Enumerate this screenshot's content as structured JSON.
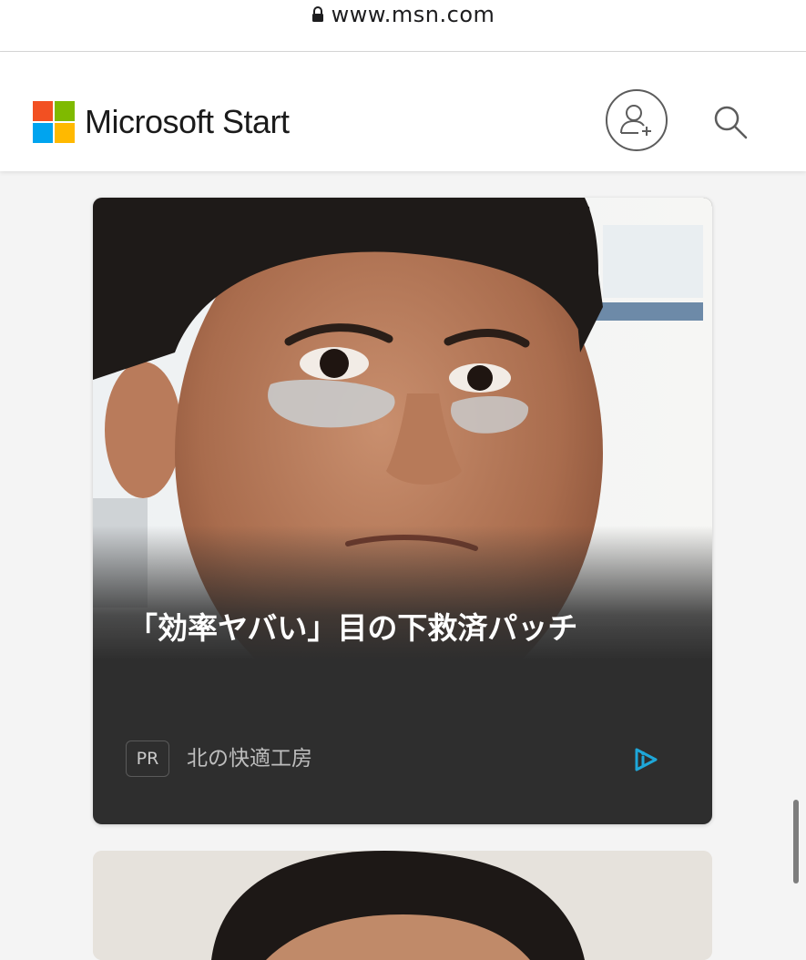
{
  "browser": {
    "url": "www.msn.com",
    "icons": {
      "lock": "lock-icon"
    }
  },
  "header": {
    "brand": "Microsoft Start",
    "logo_colors": [
      "#f25022",
      "#7fba00",
      "#00a4ef",
      "#ffb900"
    ],
    "profile_icon": "add-user-icon",
    "search_icon": "search-icon"
  },
  "card": {
    "title": "「効率ヤバい」目の下救済パッチ",
    "badge": "PR",
    "sponsor": "北の快適工房",
    "adchoices_icon": "adchoices-icon",
    "adchoices_color": "#1ea7d9",
    "image": "man-with-under-eye-patches"
  },
  "card2": {
    "image": "man-portrait-partial"
  }
}
